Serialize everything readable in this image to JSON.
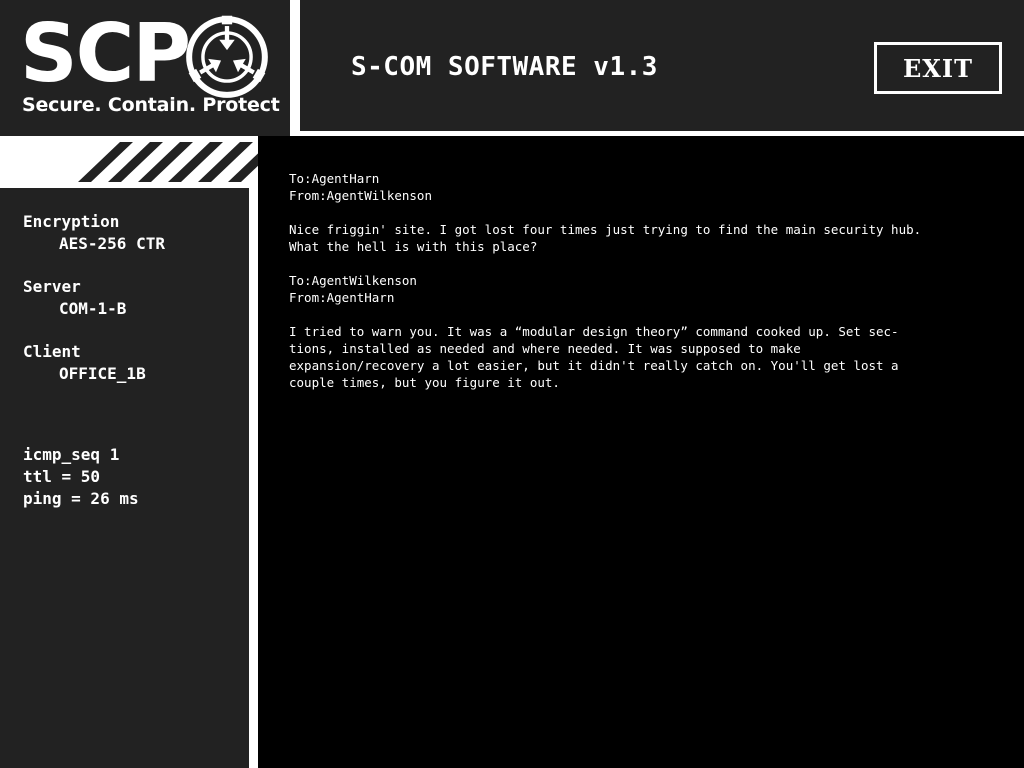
{
  "logo": {
    "text": "SCP",
    "tagline": "Secure. Contain. Protect",
    "emblem_icon": "scp-emblem-icon"
  },
  "header": {
    "title": "S-COM SOFTWARE v1.3",
    "exit_label": "EXIT"
  },
  "sidebar": {
    "encryption_label": "Encryption",
    "encryption_value": "AES-256 CTR",
    "server_label": "Server",
    "server_value": "COM-1-B",
    "client_label": "Client",
    "client_value": "OFFICE_1B",
    "stats": [
      "icmp_seq 1",
      "ttl = 50",
      "ping = 26 ms"
    ]
  },
  "messages": [
    {
      "to": "To:AgentHarn",
      "from": "From:AgentWilkenson",
      "body": [
        "Nice friggin' site. I got lost four times just trying to find the main security hub.",
        "What the hell is with this place?"
      ]
    },
    {
      "to": "To:AgentWilkenson",
      "from": "From:AgentHarn",
      "body": [
        "I tried to warn you. It was a “modular design theory” command cooked up. Set sec-",
        "tions, installed as needed and where needed. It was supposed to make",
        "expansion/recovery a lot easier, but it didn't really catch on. You'll get lost a",
        "couple times, but you figure it out."
      ]
    }
  ],
  "colors": {
    "panel": "#222222",
    "frame": "#ffffff",
    "terminal": "#000000",
    "text": "#ffffff"
  }
}
